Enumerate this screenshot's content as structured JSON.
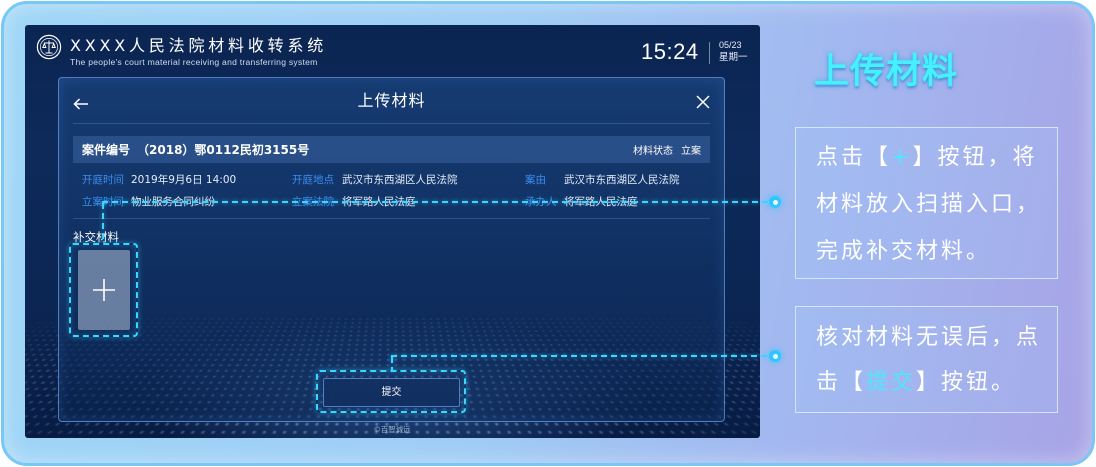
{
  "header": {
    "emblem_icon": "court-emblem-icon",
    "system_title": "XXXX人民法院材料收转系统",
    "system_subtitle": "The people's court material receiving and transferring system",
    "time": "15:24",
    "date": "05/23",
    "weekday": "星期一"
  },
  "modal": {
    "back_icon": "back-arrow-icon",
    "title": "上传材料",
    "close_icon": "close-icon",
    "case_summary": {
      "number_label": "案件编号",
      "number_value": "（2018）鄂0112民初3155号",
      "status_label": "材料状态",
      "status_value": "立案"
    },
    "case_fields": [
      {
        "label": "开庭时间",
        "value": "2019年9月6日 14:00"
      },
      {
        "label": "开庭地点",
        "value": "武汉市东西湖区人民法院"
      },
      {
        "label": "案由",
        "value": "武汉市东西湖区人民法院"
      },
      {
        "label": "立案时间",
        "value": "物业服务合同纠纷"
      },
      {
        "label": "立案法院",
        "value": "将军路人民法庭"
      },
      {
        "label": "承办人",
        "value": "将军路人民法庭"
      }
    ],
    "supplement": {
      "label": "补交材料",
      "add_icon": "plus-icon"
    },
    "submit_label": "提交"
  },
  "footer": {
    "copyright": "©百智诚远"
  },
  "guide": {
    "title": "上传材料",
    "steps": [
      {
        "lines": [
          [
            {
              "text": "点击【"
            },
            {
              "text": "+",
              "highlight": true
            },
            {
              "text": "】按钮，将"
            }
          ],
          [
            {
              "text": "材料放入扫描入口，"
            }
          ],
          [
            {
              "text": "完成补交材料。"
            }
          ]
        ]
      },
      {
        "lines": [
          [
            {
              "text": "核对材料无误后，点"
            }
          ],
          [
            {
              "text": "击【"
            },
            {
              "text": "提交",
              "highlight": true
            },
            {
              "text": "】按钮。"
            }
          ]
        ]
      }
    ]
  },
  "colors": {
    "screen_bg": "#0d2a5a",
    "modal_bg": "#15396b",
    "field_label": "#3b8ef2",
    "highlight_dash": "#3ad6ff",
    "guide_title": "#45f0ff",
    "guide_highlight": "#4fe6ff",
    "frame_left": "#9fd6f7",
    "frame_right": "#a7a3e6"
  }
}
